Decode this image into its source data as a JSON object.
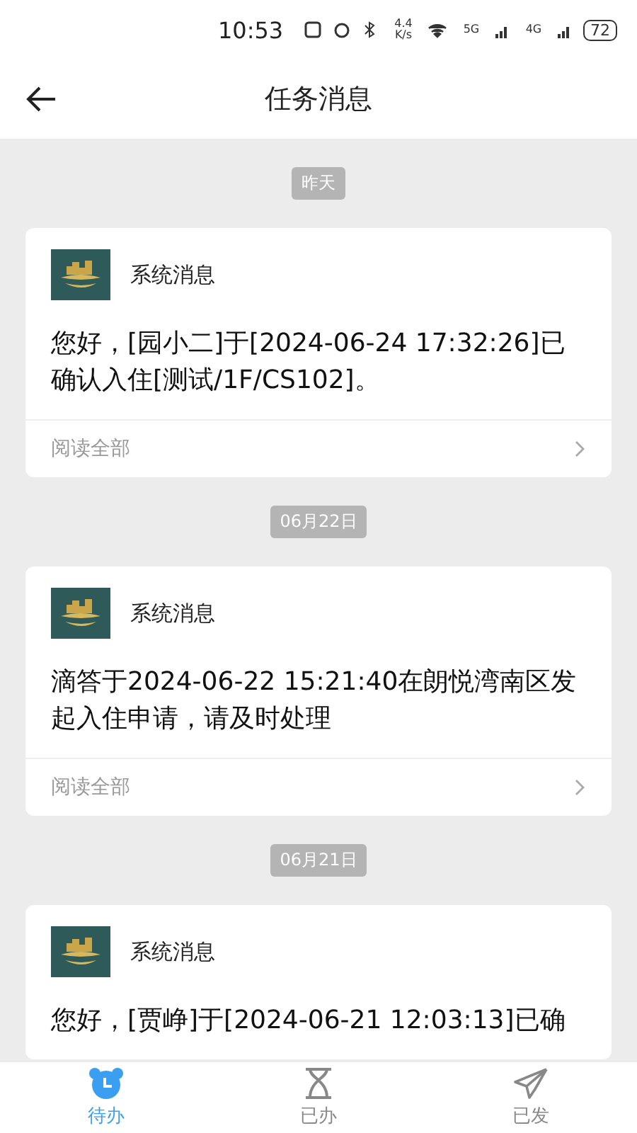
{
  "status_bar": {
    "time": "10:53",
    "speed": "4.4 K/s",
    "signals": [
      "5G",
      "4G"
    ],
    "battery": "72"
  },
  "header": {
    "title": "任务消息"
  },
  "messages": [
    {
      "date": "昨天",
      "sender": "系统消息",
      "body": "您好，[园小二]于[2024-06-24 17:32:26]已确认入住[测试/1F/CS102]。",
      "footer": "阅读全部"
    },
    {
      "date": "06月22日",
      "sender": "系统消息",
      "body": "滴答于2024-06-22 15:21:40在朗悦湾南区发起入住申请，请及时处理",
      "footer": "阅读全部"
    },
    {
      "date": "06月21日",
      "sender": "系统消息",
      "body": "您好，[贾峥]于[2024-06-21 12:03:13]已确"
    }
  ],
  "tabs": [
    {
      "label": "待办",
      "kind": "clock",
      "selected": true
    },
    {
      "label": "已办",
      "kind": "hourglass",
      "selected": false
    },
    {
      "label": "已发",
      "kind": "send",
      "selected": false
    }
  ]
}
